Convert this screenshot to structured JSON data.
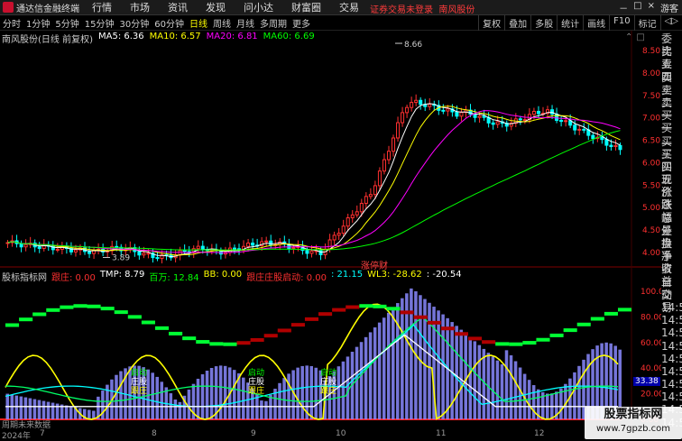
{
  "app": {
    "title": "通达信金融终端",
    "menu": [
      "行情",
      "市场",
      "资讯",
      "发现",
      "问小达",
      "财富圈",
      "交易"
    ],
    "warning": "证券交易未登录",
    "stock_short": "南风股份",
    "right_tools": [
      "－",
      "□",
      "×"
    ],
    "guest": "游客"
  },
  "toolbar": {
    "periods": [
      "分时",
      "1分钟",
      "5分钟",
      "15分钟",
      "30分钟",
      "60分钟",
      "日线",
      "周线",
      "月线",
      "多周期",
      "更多"
    ],
    "active_period": "日线",
    "tools": [
      "复权",
      "叠加",
      "多股",
      "统计",
      "画线",
      "F10",
      "标记",
      "◁▷"
    ]
  },
  "stock_header": {
    "name": "南风股份(日线 前复权)",
    "ma5": "MA5: 6.36",
    "ma10": "MA10: 6.57",
    "ma20": "MA20: 6.81",
    "ma60": "MA60: 6.69"
  },
  "indicator_header": {
    "name": "股标指标网",
    "label1": "跟庄: 0.00",
    "tmp": "TMP: 8.79",
    "baiwan": "百万: 12.84",
    "bb": "BB: 0.00",
    "follow": "跟庄庄股启动: 0.00",
    "v1": ": 21.15",
    "wl3": "WL3: -28.62",
    "v2": ": -20.54"
  },
  "price_axis": [
    "8.50",
    "8.00",
    "7.50",
    "7.00",
    "6.50",
    "6.00",
    "5.50",
    "5.00",
    "4.50",
    "4.00"
  ],
  "ind_axis": [
    "100.0",
    "80.00",
    "60.00",
    "40.00",
    "20.00",
    "0.00"
  ],
  "high_label": "8.66",
  "low_label": "3.89",
  "badge": "涨停财",
  "ind_value": "33.38",
  "signals": [
    {
      "a": "启动",
      "b": "庄股",
      "c": "跟庄"
    },
    {
      "a": "启动",
      "b": "庄股",
      "c": "跟庄"
    },
    {
      "a": "启动",
      "b": "庄股",
      "c": "跟庄"
    }
  ],
  "right_panel": [
    "委比",
    "卖五",
    "卖四",
    "卖三",
    "卖二",
    "卖一",
    "买一",
    "买二",
    "买三",
    "买四",
    "买五",
    "现价",
    "涨跌",
    "涨幅",
    "总量",
    "外盘",
    "换手",
    "净资",
    "收益",
    "自动",
    "交易",
    "14:5",
    "14:5",
    "14:5",
    "14:5",
    "14:5",
    "14:5",
    "14:5",
    "14:5",
    "14:5",
    "14:5"
  ],
  "dates": [
    "2024年",
    "7",
    "8",
    "9",
    "10",
    "11",
    "12"
  ],
  "no_data": "周期未来数据",
  "watermark": {
    "line1": "股票指标网",
    "line2": "www.7gpzb.com"
  },
  "colors": {
    "up": "#ff3030",
    "down": "#00ffff",
    "ma5": "#ffffff",
    "ma10": "#ffff00",
    "ma20": "#ff00ff",
    "ma60": "#00ff00"
  }
}
